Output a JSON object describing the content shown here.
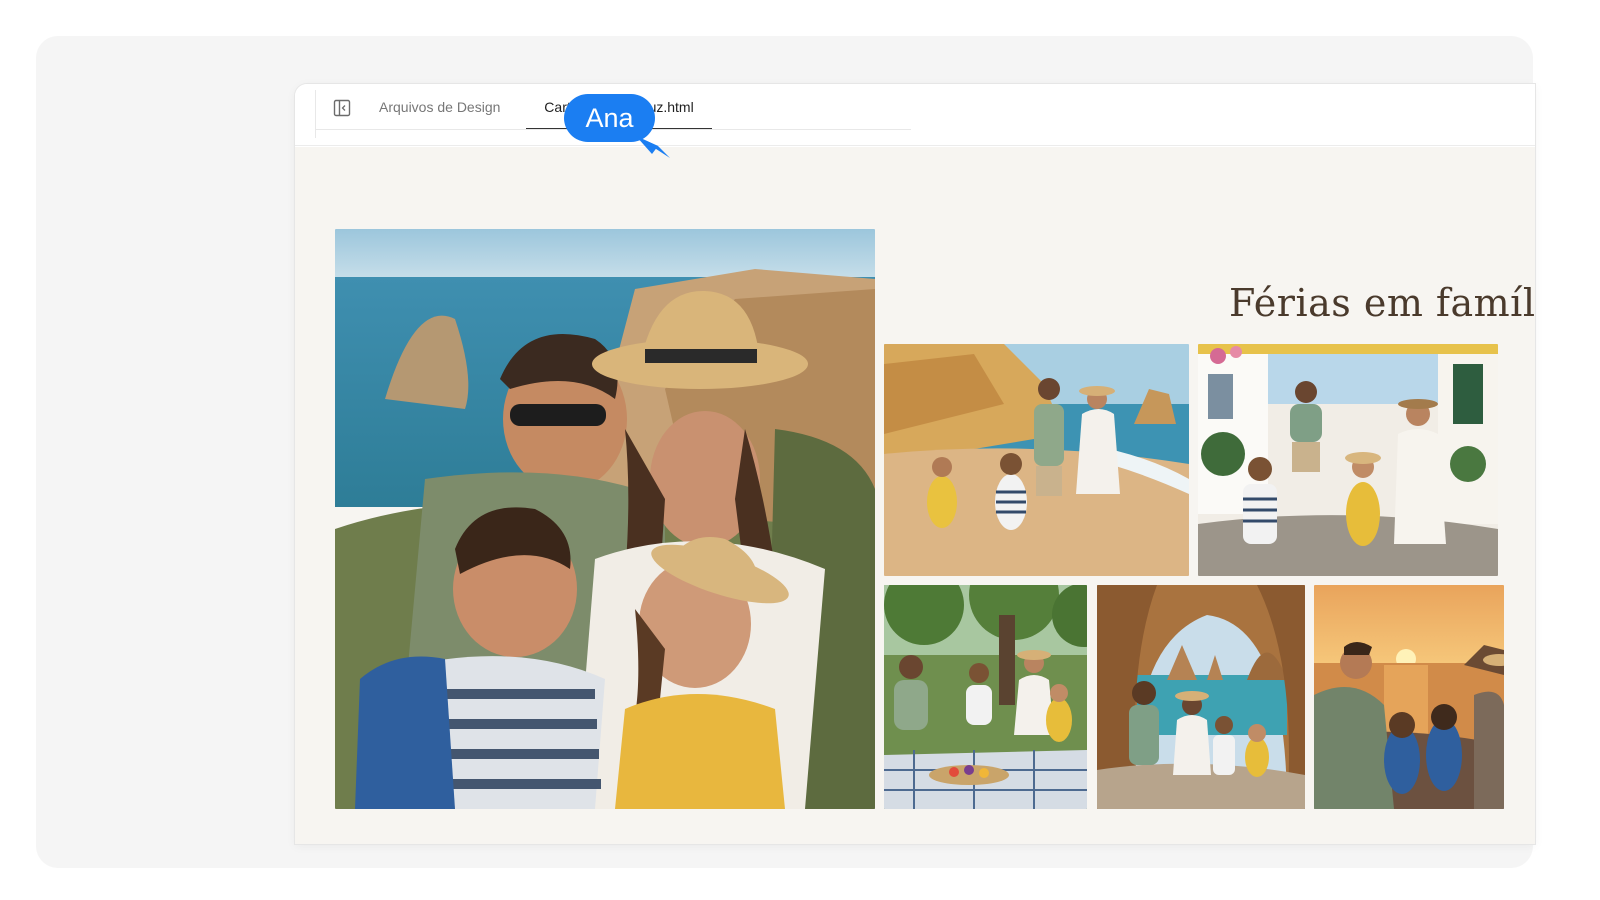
{
  "tabs": [
    {
      "label": "Arquivos de Design",
      "active": false
    },
    {
      "label": "Cartão Estúdio Luz.html",
      "active": true
    }
  ],
  "page": {
    "title": "Férias em família"
  },
  "cursor": {
    "name": "Ana",
    "color": "#1b7ef2"
  },
  "photos": [
    {
      "subject": "family portrait on coastal cliff"
    },
    {
      "subject": "family walking on beach"
    },
    {
      "subject": "family on whitewashed village street"
    },
    {
      "subject": "family picnic under tree"
    },
    {
      "subject": "family in sea cave facing cove"
    },
    {
      "subject": "family watching sunset"
    }
  ],
  "colors": {
    "canvas_bg": "#f7f5f1",
    "title_text": "#4a3a2c",
    "accent": "#1b7ef2"
  }
}
